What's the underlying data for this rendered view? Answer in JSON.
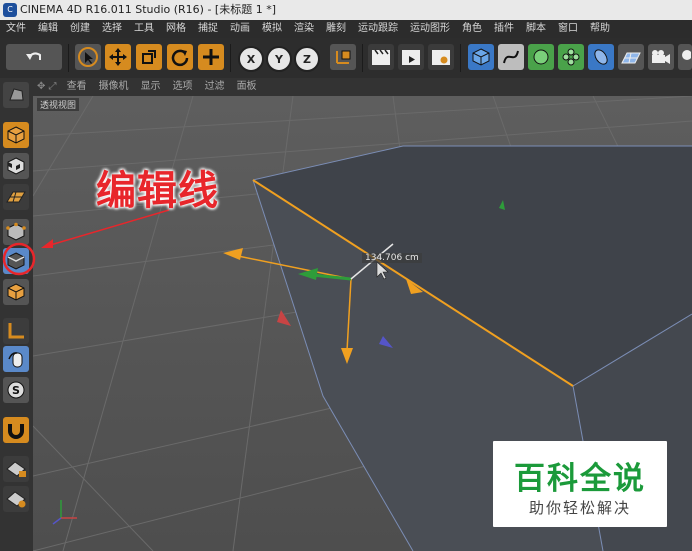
{
  "window": {
    "title": "CINEMA 4D R16.011 Studio (R16) - [未标题 1 *]",
    "app_icon": "c4d-logo-icon"
  },
  "menubar": {
    "items": [
      "文件",
      "编辑",
      "创建",
      "选择",
      "工具",
      "网格",
      "捕捉",
      "动画",
      "模拟",
      "渲染",
      "雕刻",
      "运动跟踪",
      "运动图形",
      "角色",
      "插件",
      "脚本",
      "窗口",
      "帮助"
    ]
  },
  "toolbar": {
    "x_label": "X",
    "y_label": "Y",
    "z_label": "Z"
  },
  "viewport": {
    "menu": [
      "查看",
      "摄像机",
      "显示",
      "选项",
      "过滤",
      "面板"
    ],
    "label": "透视视图",
    "measure": "134.706 cm"
  },
  "annotation": {
    "text": "编辑线",
    "color": "#e8262b"
  },
  "watermark": {
    "title": "百科全说",
    "subtitle": "助你轻松解决"
  },
  "colors": {
    "accent": "#d68b1f",
    "selection_edge": "#f0a020",
    "annotation": "#e8262b",
    "watermark_green": "#1b9a3a"
  }
}
